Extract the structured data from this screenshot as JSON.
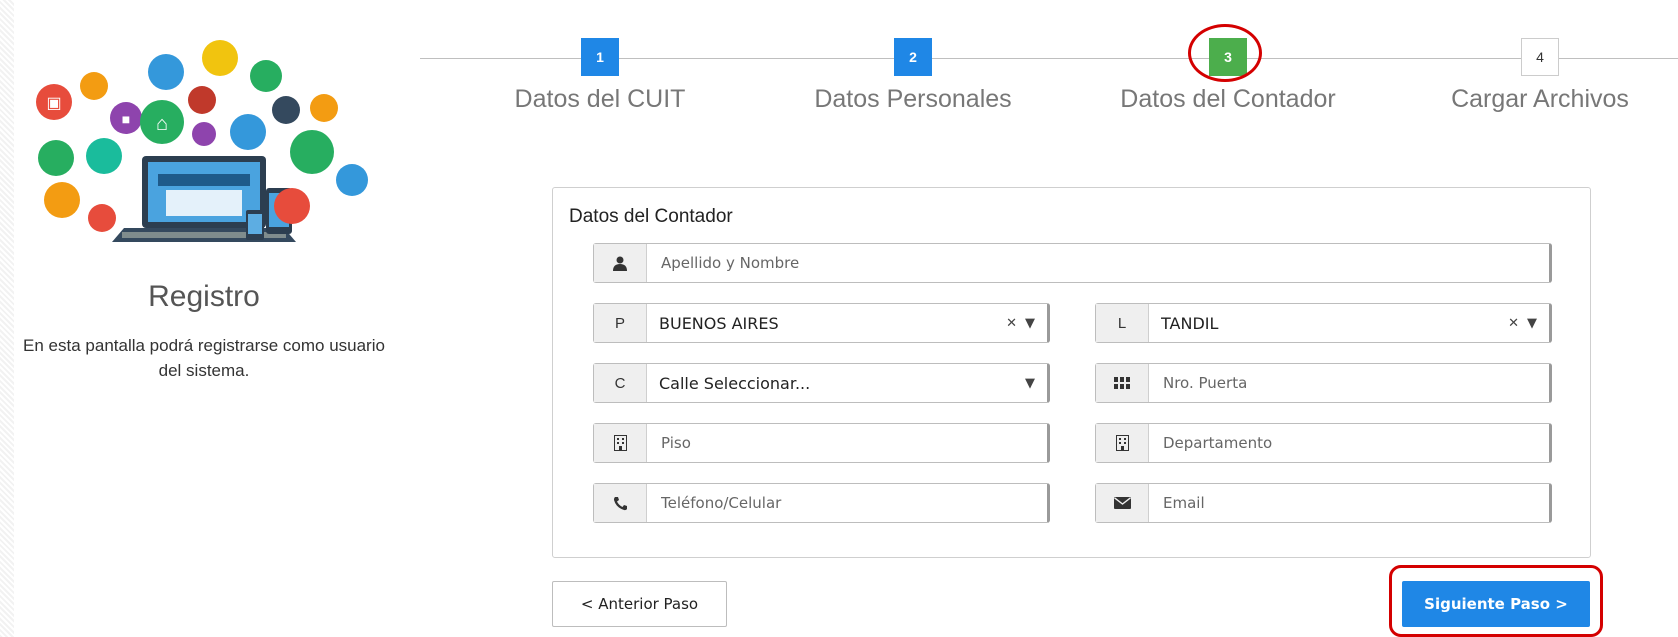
{
  "sidebar": {
    "title": "Registro",
    "description": "En esta pantalla podrá registrarse como usuario del sistema."
  },
  "stepper": {
    "steps": [
      {
        "number": "1",
        "label": "Datos del CUIT",
        "state": "complete",
        "color": "#1f87e6"
      },
      {
        "number": "2",
        "label": "Datos Personales",
        "state": "complete",
        "color": "#1f87e6"
      },
      {
        "number": "3",
        "label": "Datos del Contador",
        "state": "active",
        "color": "#4cae4c"
      },
      {
        "number": "4",
        "label": "Cargar Archivos",
        "state": "pending",
        "color": "#ffffff"
      }
    ]
  },
  "form": {
    "title": "Datos del Contador",
    "apellido": {
      "icon": "user-icon",
      "placeholder": "Apellido y Nombre",
      "value": ""
    },
    "provincia": {
      "addon": "P",
      "value": "BUENOS AIRES"
    },
    "localidad": {
      "addon": "L",
      "value": "TANDIL"
    },
    "calle": {
      "addon": "C",
      "value": "Calle Seleccionar..."
    },
    "nro_puerta": {
      "icon": "grid-icon",
      "placeholder": "Nro. Puerta",
      "value": ""
    },
    "piso": {
      "icon": "building-icon",
      "placeholder": "Piso",
      "value": ""
    },
    "departamento": {
      "icon": "building-icon",
      "placeholder": "Departamento",
      "value": ""
    },
    "telefono": {
      "icon": "phone-icon",
      "placeholder": "Teléfono/Celular",
      "value": ""
    },
    "email": {
      "icon": "envelope-icon",
      "placeholder": "Email",
      "value": ""
    }
  },
  "buttons": {
    "prev": "< Anterior Paso",
    "next": "Siguiente Paso >"
  },
  "colors": {
    "primary": "#1f87e6",
    "active_step": "#4cae4c",
    "highlight": "#d40000"
  }
}
